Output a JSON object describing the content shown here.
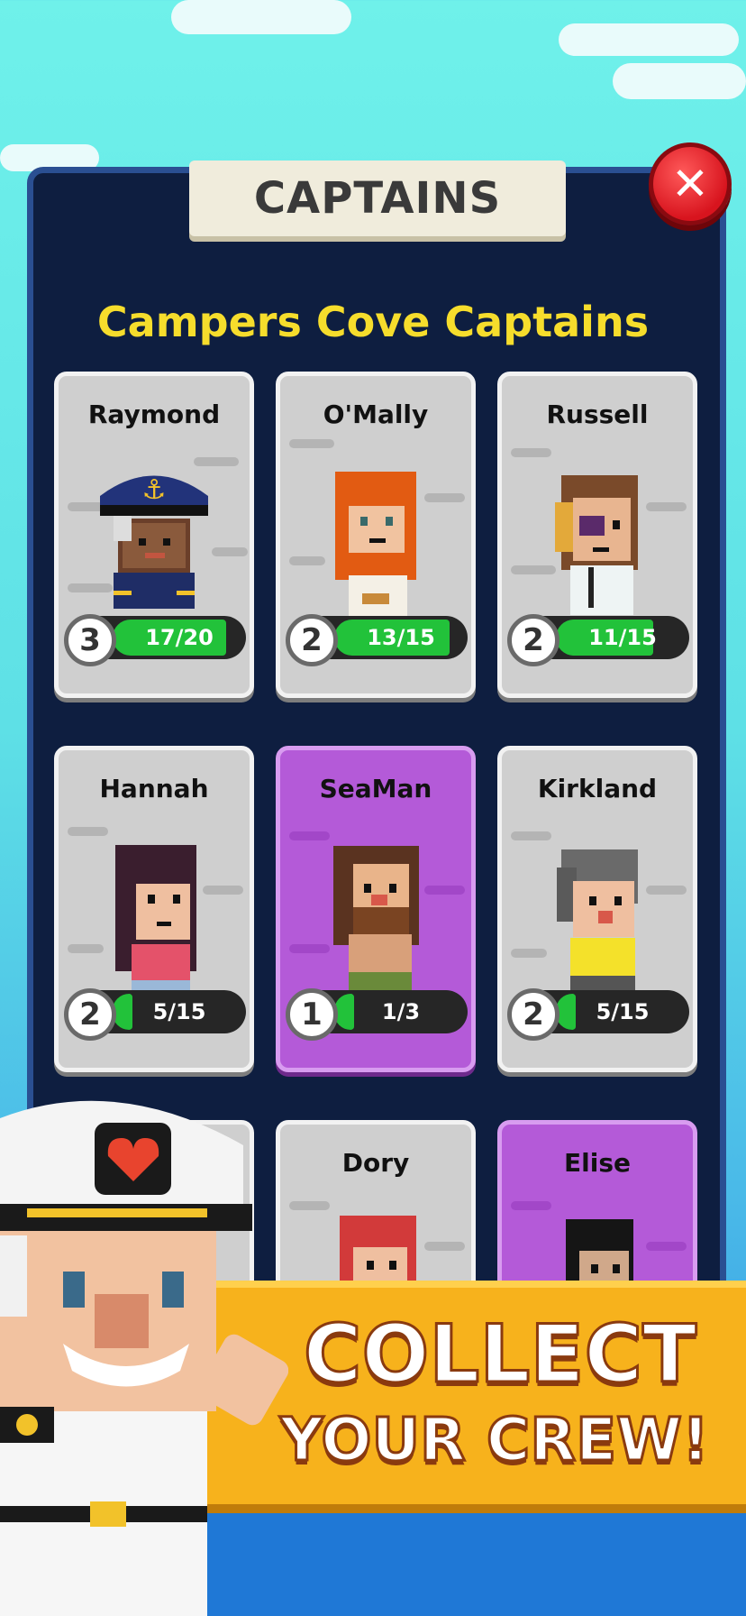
{
  "panel": {
    "title": "CAPTAINS",
    "close_icon_label": "✕",
    "subtitle": "Campers Cove Captains"
  },
  "captains": [
    {
      "name": "Raymond",
      "level": "3",
      "progress": "17/20",
      "fill": 0.85,
      "rarity": "common"
    },
    {
      "name": "O'Mally",
      "level": "2",
      "progress": "13/15",
      "fill": 0.87,
      "rarity": "common"
    },
    {
      "name": "Russell",
      "level": "2",
      "progress": "11/15",
      "fill": 0.73,
      "rarity": "common"
    },
    {
      "name": "Hannah",
      "level": "2",
      "progress": "5/15",
      "fill": 0.33,
      "rarity": "common"
    },
    {
      "name": "SeaMan",
      "level": "1",
      "progress": "1/3",
      "fill": 0.33,
      "rarity": "epic"
    },
    {
      "name": "Kirkland",
      "level": "2",
      "progress": "5/15",
      "fill": 0.33,
      "rarity": "common"
    },
    {
      "name": "Dory",
      "rarity": "common"
    },
    {
      "name": "Elise",
      "rarity": "epic"
    }
  ],
  "promo": {
    "line1": "COLLECT",
    "line2": "YOUR CREW!"
  },
  "colors": {
    "panel": "#0e1e40",
    "subtitle": "#f6dd2c",
    "progress_fill": "#22c23a",
    "epic_card": "#b45ad8",
    "banner": "#f7b21c"
  }
}
